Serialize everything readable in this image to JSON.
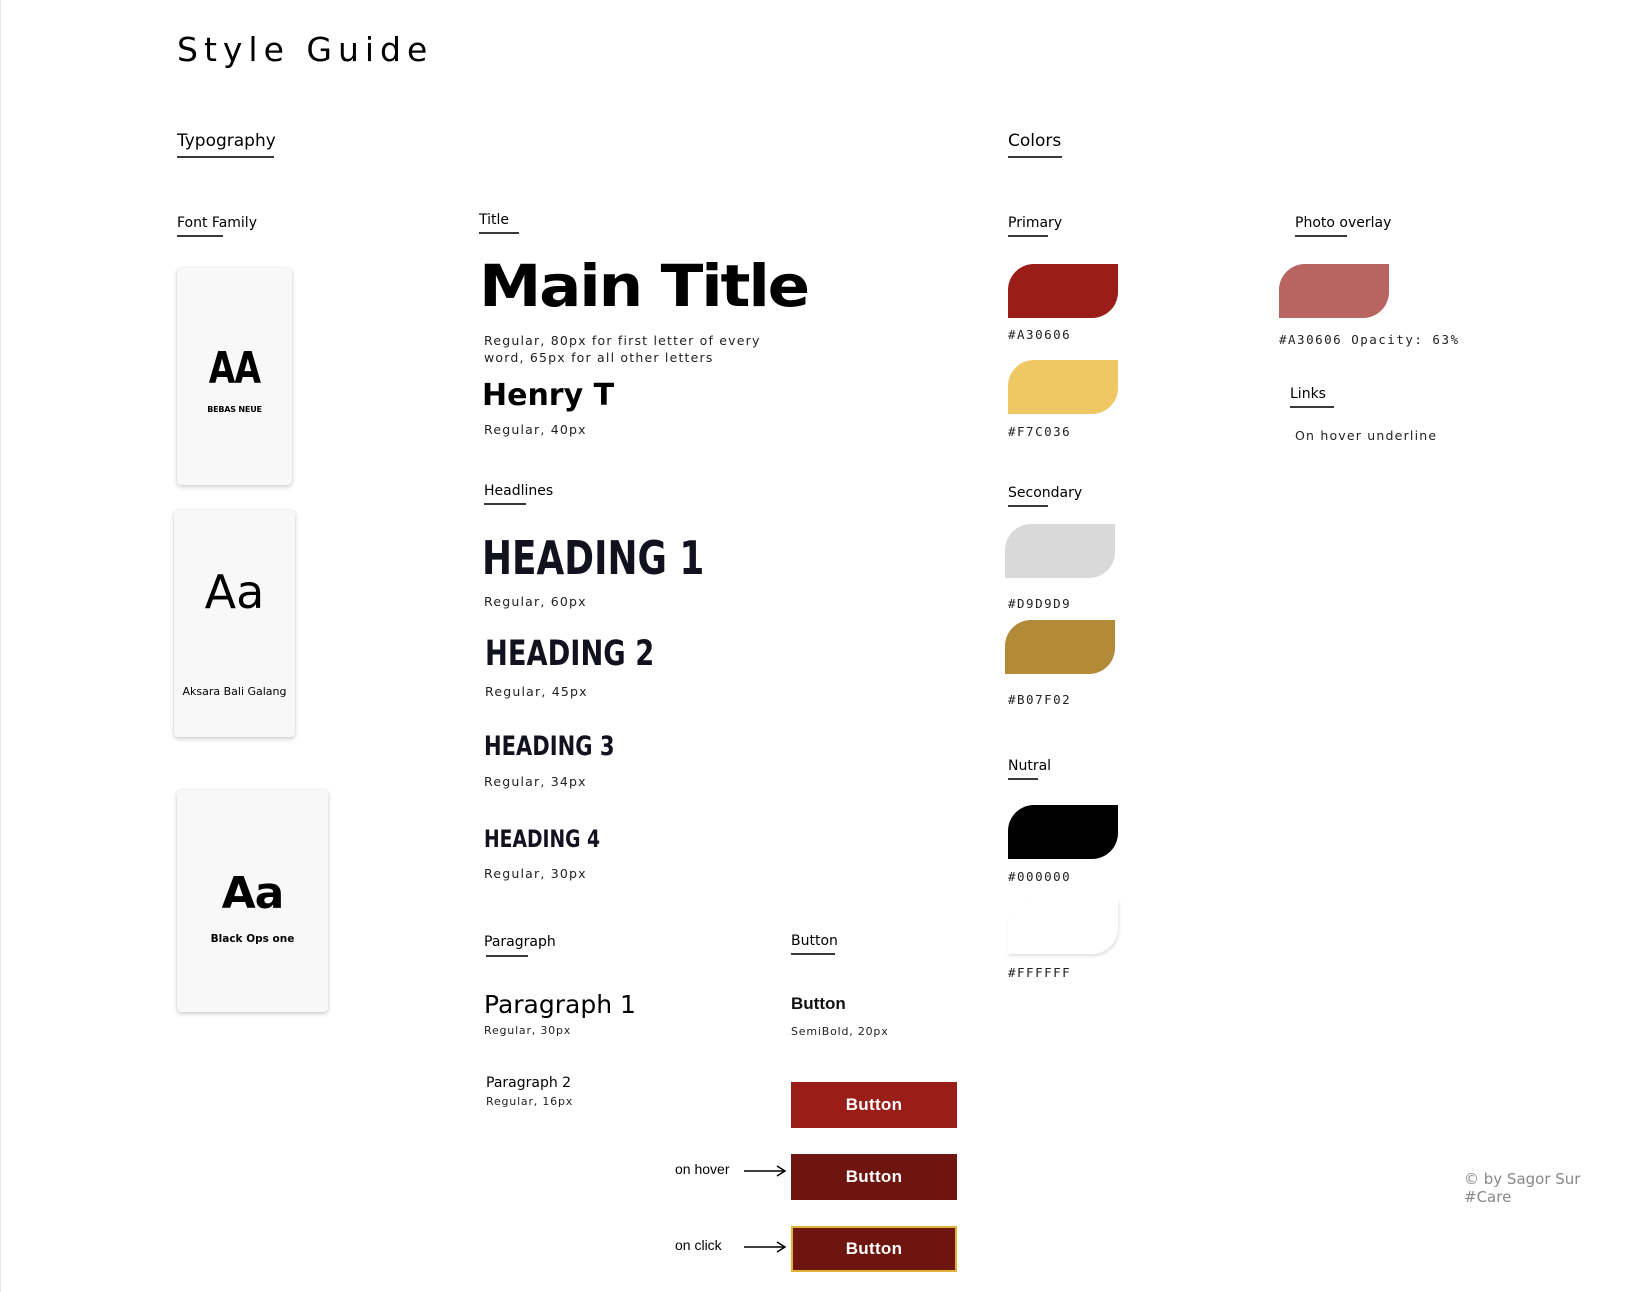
{
  "page": {
    "title": "Style Guide",
    "footer": "© by Sagor Sur #Care"
  },
  "typography": {
    "heading": "Typography",
    "font_family": {
      "label": "Font Family",
      "cards": [
        {
          "glyph": "AA",
          "name": "BEBAS NEUE"
        },
        {
          "glyph": "Aa",
          "name": "Aksara Bali Galang"
        },
        {
          "glyph": "Aa",
          "name": "Black Ops one"
        }
      ]
    },
    "title": {
      "label": "Title",
      "main_title": "Main Title",
      "main_spec_line1": "Regular, 80px for first letter of every",
      "main_spec_line2": "word, 65px for all other letters",
      "sub_title": "Henry T",
      "sub_spec": "Regular, 40px"
    },
    "headlines": {
      "label": "Headlines",
      "items": [
        {
          "text": "HEADING 1",
          "spec": "Regular, 60px"
        },
        {
          "text": "HEADING 2",
          "spec": "Regular, 45px"
        },
        {
          "text": "HEADING 3",
          "spec": "Regular, 34px"
        },
        {
          "text": "HEADING 4",
          "spec": "Regular, 30px"
        }
      ]
    },
    "paragraph": {
      "label": "Paragraph",
      "p1": "Paragraph 1",
      "p1_spec": "Regular, 30px",
      "p2": "Paragraph 2",
      "p2_spec": "Regular, 16px"
    },
    "button": {
      "label": "Button",
      "sample": "Button",
      "sample_spec": "SemiBold, 20px",
      "states": [
        {
          "text": "Button",
          "note": "",
          "color": "#A30606"
        },
        {
          "text": "Button",
          "note": "on hover",
          "color": "#6E0F0A"
        },
        {
          "text": "Button",
          "note": "on click",
          "color": "#6E0F0A",
          "border": "#F7C036"
        }
      ]
    }
  },
  "colors": {
    "heading": "Colors",
    "primary": {
      "label": "Primary",
      "swatches": [
        {
          "hex": "#A30606",
          "color": "#9B1D17"
        },
        {
          "hex": "#F7C036",
          "color": "#EFC763"
        }
      ]
    },
    "secondary": {
      "label": "Secondary",
      "swatches": [
        {
          "hex": "#D9D9D9",
          "color": "#D9D9D9"
        },
        {
          "hex": "#B07F02",
          "color": "#B28A38"
        }
      ]
    },
    "nutral": {
      "label": "Nutral",
      "swatches": [
        {
          "hex": "#000000",
          "color": "#000000"
        },
        {
          "hex": "#FFFFFF",
          "color": "#FFFFFF"
        }
      ]
    },
    "photo_overlay": {
      "label": "Photo overlay",
      "hex": "#A30606 Opacity: 63%",
      "color": "#BA6461"
    },
    "links": {
      "label": "Links",
      "text": "On hover underline"
    }
  }
}
